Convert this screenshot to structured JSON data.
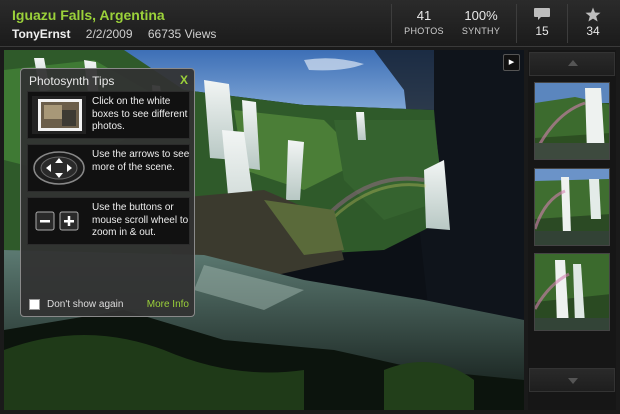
{
  "header": {
    "title": "Iguazu Falls, Argentina",
    "author": "TonyErnst",
    "date": "2/2/2009",
    "views": "66735 Views",
    "photos_count": "41",
    "photos_label": "PHOTOS",
    "synthy_value": "100%",
    "synthy_label": "SYNTHY",
    "comments_count": "15",
    "favorites_count": "34"
  },
  "tips": {
    "title": "Photosynth Tips",
    "close": "X",
    "items": [
      {
        "text": "Click on the white boxes to see different photos.",
        "icon": "photo-box-icon"
      },
      {
        "text": "Use the arrows to see more of the scene.",
        "icon": "arrow-pad-icon"
      },
      {
        "text": "Use the buttons or mouse scroll wheel to zoom in & out.",
        "icon": "zoom-buttons-icon"
      }
    ],
    "dont_show": "Don't show again",
    "more_info": "More Info"
  },
  "icons": {
    "comment": "speech-bubble-icon",
    "favorite": "star-icon",
    "expand": "chevron-right-icon",
    "scroll_up": "triangle-up-icon",
    "scroll_down": "triangle-down-icon"
  },
  "colors": {
    "accent": "#9bd13a",
    "background": "#1a1a1a"
  }
}
